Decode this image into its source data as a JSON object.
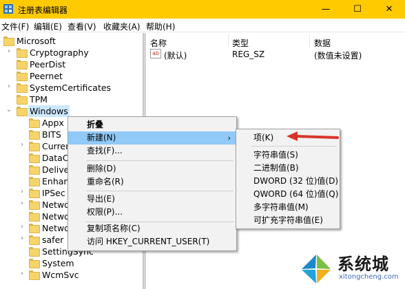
{
  "window": {
    "title": "注册表编辑器",
    "controls": {
      "minimize": "—",
      "maximize": "☐",
      "close": "✕"
    }
  },
  "menubar": [
    {
      "label": "文件(F)"
    },
    {
      "label": "编辑(E)"
    },
    {
      "label": "查看(V)"
    },
    {
      "label": "收藏夹(A)"
    },
    {
      "label": "帮助(H)"
    }
  ],
  "tree": [
    {
      "label": "Microsoft",
      "arrow": ""
    },
    {
      "label": "Cryptography",
      "arrow": "›"
    },
    {
      "label": "PeerDist",
      "arrow": ""
    },
    {
      "label": "Peernet",
      "arrow": ""
    },
    {
      "label": "SystemCertificates",
      "arrow": "›"
    },
    {
      "label": "TPM",
      "arrow": ""
    },
    {
      "label": "Windows",
      "arrow": "⌄"
    },
    {
      "label": "Appx",
      "arrow": ""
    },
    {
      "label": "BITS",
      "arrow": ""
    },
    {
      "label": "Curren",
      "arrow": "›"
    },
    {
      "label": "DataC",
      "arrow": ""
    },
    {
      "label": "Delive",
      "arrow": ""
    },
    {
      "label": "Enhan",
      "arrow": ""
    },
    {
      "label": "IPSec",
      "arrow": "›"
    },
    {
      "label": "Netwo",
      "arrow": "›"
    },
    {
      "label": "Netwo",
      "arrow": ""
    },
    {
      "label": "Netwo",
      "arrow": "›"
    },
    {
      "label": "safer",
      "arrow": "›"
    },
    {
      "label": "SettingSync",
      "arrow": ""
    },
    {
      "label": "System",
      "arrow": ""
    },
    {
      "label": "WcmSvc",
      "arrow": "›"
    }
  ],
  "values_pane": {
    "headers": {
      "name": "名称",
      "type": "类型",
      "data": "数据"
    },
    "rows": [
      {
        "icon": "ab",
        "name": "(默认)",
        "type": "REG_SZ",
        "data": "(数值未设置)"
      }
    ]
  },
  "context_menu": {
    "items": [
      {
        "label": "折叠",
        "bold": true
      },
      {
        "label": "新建(N)",
        "highlighted": true,
        "submenu_arrow": "›"
      },
      {
        "label": "查找(F)..."
      },
      {
        "label": "删除(D)"
      },
      {
        "label": "重命名(R)"
      },
      {
        "label": "导出(E)"
      },
      {
        "label": "权限(P)..."
      },
      {
        "label": "复制项名称(C)"
      },
      {
        "label": "访问 HKEY_CURRENT_USER(T)"
      }
    ]
  },
  "submenu": {
    "items": [
      {
        "label": "项(K)"
      },
      {
        "label": "字符串值(S)"
      },
      {
        "label": "二进制值(B)"
      },
      {
        "label": "DWORD (32 位)值(D)"
      },
      {
        "label": "QWORD (64 位)值(Q)"
      },
      {
        "label": "多字符串值(M)"
      },
      {
        "label": "可扩充字符串值(E)"
      }
    ]
  },
  "watermark": {
    "text": "系统城",
    "url": "xitongcheng.com"
  },
  "colors": {
    "titlebar": "#ffcb00",
    "highlight": "#91c9f7",
    "selected": "#cce8ff",
    "arrow": "#d9342b"
  }
}
